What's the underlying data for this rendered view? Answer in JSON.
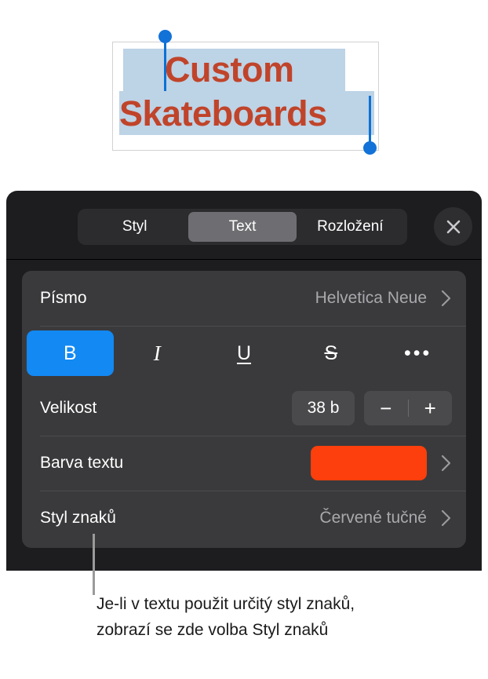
{
  "canvas": {
    "document_text_lines": [
      "Custom",
      "Skateboards"
    ],
    "text_color": "#c0442a",
    "selection_highlight_color": "#bdd3e6",
    "handle_color": "#1272d8"
  },
  "panel": {
    "tabs": [
      {
        "label": "Styl",
        "active": false
      },
      {
        "label": "Text",
        "active": true
      },
      {
        "label": "Rozložení",
        "active": false
      }
    ],
    "close_icon": "close-icon",
    "rows": {
      "font": {
        "label": "Písmo",
        "value": "Helvetica Neue"
      },
      "format_buttons": [
        {
          "name": "bold",
          "glyph": "B",
          "active": true
        },
        {
          "name": "italic",
          "glyph": "I",
          "active": false
        },
        {
          "name": "underline",
          "glyph": "U",
          "active": false
        },
        {
          "name": "strikethrough",
          "glyph": "S",
          "active": false
        },
        {
          "name": "more",
          "glyph": "•••",
          "active": false
        }
      ],
      "size": {
        "label": "Velikost",
        "value": "38 b",
        "decrement": "−",
        "increment": "+"
      },
      "text_color": {
        "label": "Barva textu",
        "swatch_color": "#fc3f0c"
      },
      "character_style": {
        "label": "Styl znaků",
        "value": "Červené tučné"
      }
    },
    "accent_color": "#1289f3",
    "selected_tab_color": "#6e6e72"
  },
  "callout": {
    "text": "Je-li v textu použit určitý styl znaků, zobrazí se zde volba Styl znaků"
  }
}
